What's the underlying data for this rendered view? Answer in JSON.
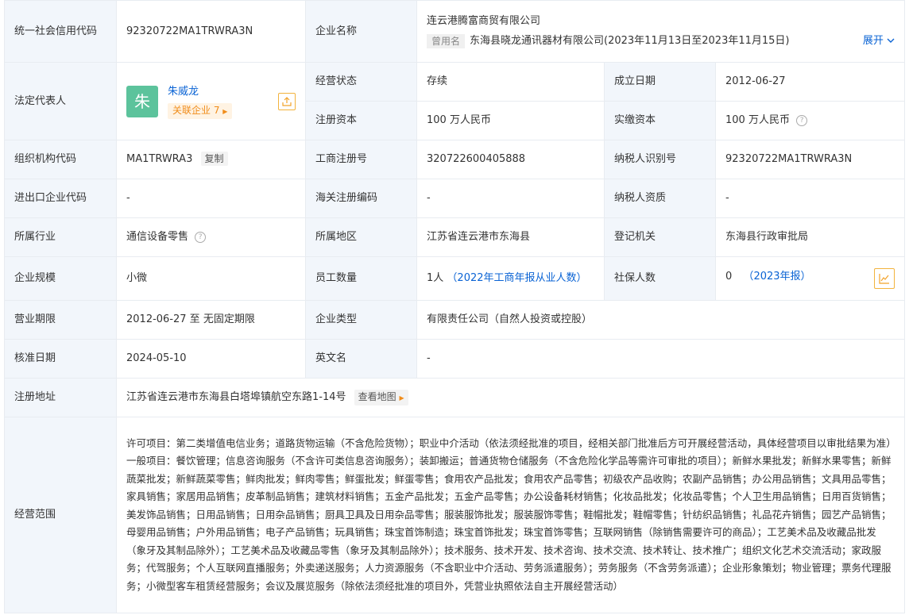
{
  "labels": {
    "credit_code": "统一社会信用代码",
    "company_name": "企业名称",
    "legal_rep": "法定代表人",
    "status": "经营状态",
    "established": "成立日期",
    "reg_capital": "注册资本",
    "paid_capital": "实缴资本",
    "org_code": "组织机构代码",
    "biz_reg_no": "工商注册号",
    "taxpayer_id": "纳税人识别号",
    "import_export_code": "进出口企业代码",
    "customs_code": "海关注册编码",
    "taxpayer_qual": "纳税人资质",
    "industry": "所属行业",
    "region": "所属地区",
    "reg_authority": "登记机关",
    "scale": "企业规模",
    "staff": "员工数量",
    "insured": "社保人数",
    "term": "营业期限",
    "company_type": "企业类型",
    "approve_date": "核准日期",
    "english_name": "英文名",
    "reg_address": "注册地址",
    "scope": "经营范围"
  },
  "values": {
    "credit_code": "92320722MA1TRWRA3N",
    "company_name": "连云港腾富商贸有限公司",
    "former_tag": "曾用名",
    "former_name": "东海县晓龙通讯器材有限公司(2023年11月13日至2023年11月15日)",
    "expand": "展开",
    "legal_avatar": "朱",
    "legal_name": "朱威龙",
    "related": "关联企业 7",
    "status": "存续",
    "established": "2012-06-27",
    "reg_capital": "100 万人民币",
    "paid_capital": "100 万人民币",
    "org_code": "MA1TRWRA3",
    "copy": "复制",
    "biz_reg_no": "320722600405888",
    "taxpayer_id": "92320722MA1TRWRA3N",
    "import_export_code": "-",
    "customs_code": "-",
    "taxpayer_qual": "-",
    "industry": "通信设备零售",
    "region": "江苏省连云港市东海县",
    "reg_authority": "东海县行政审批局",
    "scale": "小微",
    "staff_count": "1人",
    "staff_note": "（2022年工商年报从业人数）",
    "insured_count": "0",
    "insured_note_open": "（",
    "insured_note_link": "2023年报",
    "insured_note_close": "）",
    "term": "2012-06-27 至 无固定期限",
    "company_type": "有限责任公司（自然人投资或控股）",
    "approve_date": "2024-05-10",
    "english_name": "-",
    "reg_address": "江苏省连云港市东海县白塔埠镇航空东路1-14号",
    "view_map": "查看地图",
    "scope": "许可项目：第二类增值电信业务；道路货物运输（不含危险货物）；职业中介活动（依法须经批准的项目，经相关部门批准后方可开展经营活动，具体经营项目以审批结果为准）一般项目：餐饮管理；信息咨询服务（不含许可类信息咨询服务）；装卸搬运；普通货物仓储服务（不含危险化学品等需许可审批的项目）；新鲜水果批发；新鲜水果零售；新鲜蔬菜批发；新鲜蔬菜零售；鲜肉批发；鲜肉零售；鲜蛋批发；鲜蛋零售；食用农产品批发；食用农产品零售；初级农产品收购；农副产品销售；办公用品销售；文具用品零售；家具销售；家居用品销售；皮革制品销售；建筑材料销售；五金产品批发；五金产品零售；办公设备耗材销售；化妆品批发；化妆品零售；个人卫生用品销售；日用百货销售；美发饰品销售；日用品销售；日用杂品销售；厨具卫具及日用杂品零售；服装服饰批发；服装服饰零售；鞋帽批发；鞋帽零售；针纺织品销售；礼品花卉销售；园艺产品销售；母婴用品销售；户外用品销售；电子产品销售；玩具销售；珠宝首饰制造；珠宝首饰批发；珠宝首饰零售；互联网销售（除销售需要许可的商品）；工艺美术品及收藏品批发（象牙及其制品除外）；工艺美术品及收藏品零售（象牙及其制品除外）；技术服务、技术开发、技术咨询、技术交流、技术转让、技术推广；组织文化艺术交流活动；家政服务；代驾服务；个人互联网直播服务；外卖递送服务；人力资源服务（不含职业中介活动、劳务派遣服务）；劳务服务（不含劳务派遣）；企业形象策划；物业管理；票务代理服务；小微型客车租赁经营服务；会议及展览服务（除依法须经批准的项目外，凭营业执照依法自主开展经营活动）"
  },
  "icons": {
    "share": "share-icon",
    "question": "question-icon",
    "chart": "trend-chart-icon",
    "chevron": "chevron-down-icon",
    "caret": "caret-right-icon"
  },
  "colors": {
    "label_bg": "#f2f6fb",
    "link": "#0a63d4",
    "avatar": "#5cc39c",
    "orange": "#f08c1a"
  }
}
